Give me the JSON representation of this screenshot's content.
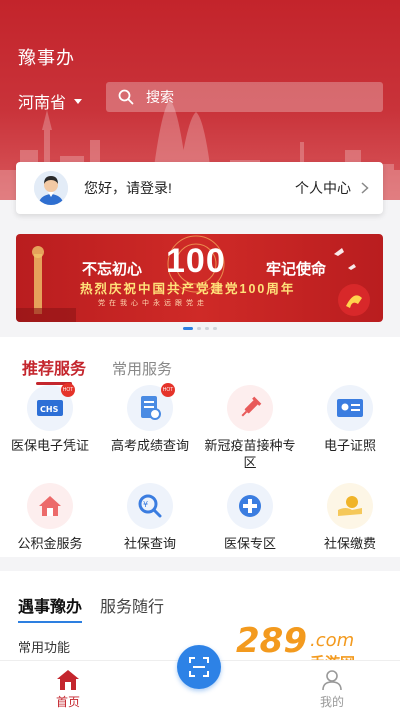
{
  "header": {
    "app_title": "豫事办",
    "province": "河南省",
    "search_placeholder": "搜索"
  },
  "login_card": {
    "greeting": "您好，请登录!",
    "personal_center": "个人中心"
  },
  "banner": {
    "slogan_left": "不忘初心",
    "number": "100",
    "slogan_right": "牢记使命",
    "subtitle": "热烈庆祝中国共产党建党100周年",
    "motto": "党在我心中永远跟党走",
    "page_count": 4,
    "active_page": 1
  },
  "services": {
    "tabs": [
      {
        "label": "推荐服务",
        "active": true
      },
      {
        "label": "常用服务",
        "active": false
      }
    ],
    "items": [
      {
        "label": "医保电子凭证",
        "icon": "medical-insurance-card-icon",
        "hot": true
      },
      {
        "label": "高考成绩查询",
        "icon": "exam-score-icon",
        "hot": true
      },
      {
        "label": "新冠疫苗接种专区",
        "icon": "vaccine-icon",
        "hot": false
      },
      {
        "label": "电子证照",
        "icon": "id-card-icon",
        "hot": false
      },
      {
        "label": "公积金服务",
        "icon": "housing-fund-icon",
        "hot": false
      },
      {
        "label": "社保查询",
        "icon": "social-security-search-icon",
        "hot": false
      },
      {
        "label": "医保专区",
        "icon": "medical-cross-icon",
        "hot": false
      },
      {
        "label": "社保缴费",
        "icon": "payment-icon",
        "hot": false
      }
    ],
    "hot_badge": "HOT"
  },
  "lower": {
    "tabs": [
      {
        "label": "遇事豫办",
        "active": true
      },
      {
        "label": "服务随行",
        "active": false
      }
    ],
    "section_title": "常用功能"
  },
  "bottom_nav": {
    "home": "首页",
    "mine": "我的"
  },
  "watermark": {
    "text": "289.com",
    "sub": "手游网"
  },
  "colors": {
    "brand_red": "#c4262d",
    "accent_blue": "#2d82e6"
  }
}
